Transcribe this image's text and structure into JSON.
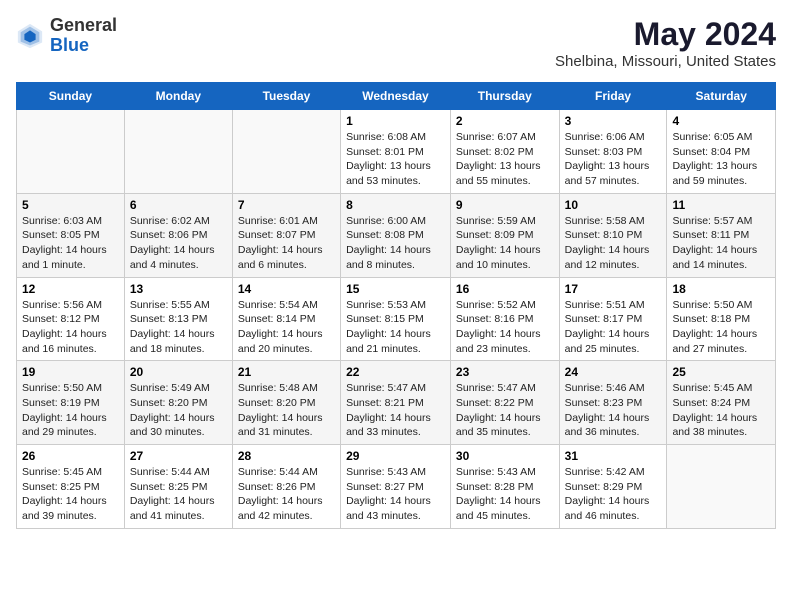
{
  "header": {
    "logo_general": "General",
    "logo_blue": "Blue",
    "title": "May 2024",
    "subtitle": "Shelbina, Missouri, United States"
  },
  "days_of_week": [
    "Sunday",
    "Monday",
    "Tuesday",
    "Wednesday",
    "Thursday",
    "Friday",
    "Saturday"
  ],
  "weeks": [
    [
      {
        "day": "",
        "info": ""
      },
      {
        "day": "",
        "info": ""
      },
      {
        "day": "",
        "info": ""
      },
      {
        "day": "1",
        "info": "Sunrise: 6:08 AM\nSunset: 8:01 PM\nDaylight: 13 hours and 53 minutes."
      },
      {
        "day": "2",
        "info": "Sunrise: 6:07 AM\nSunset: 8:02 PM\nDaylight: 13 hours and 55 minutes."
      },
      {
        "day": "3",
        "info": "Sunrise: 6:06 AM\nSunset: 8:03 PM\nDaylight: 13 hours and 57 minutes."
      },
      {
        "day": "4",
        "info": "Sunrise: 6:05 AM\nSunset: 8:04 PM\nDaylight: 13 hours and 59 minutes."
      }
    ],
    [
      {
        "day": "5",
        "info": "Sunrise: 6:03 AM\nSunset: 8:05 PM\nDaylight: 14 hours and 1 minute."
      },
      {
        "day": "6",
        "info": "Sunrise: 6:02 AM\nSunset: 8:06 PM\nDaylight: 14 hours and 4 minutes."
      },
      {
        "day": "7",
        "info": "Sunrise: 6:01 AM\nSunset: 8:07 PM\nDaylight: 14 hours and 6 minutes."
      },
      {
        "day": "8",
        "info": "Sunrise: 6:00 AM\nSunset: 8:08 PM\nDaylight: 14 hours and 8 minutes."
      },
      {
        "day": "9",
        "info": "Sunrise: 5:59 AM\nSunset: 8:09 PM\nDaylight: 14 hours and 10 minutes."
      },
      {
        "day": "10",
        "info": "Sunrise: 5:58 AM\nSunset: 8:10 PM\nDaylight: 14 hours and 12 minutes."
      },
      {
        "day": "11",
        "info": "Sunrise: 5:57 AM\nSunset: 8:11 PM\nDaylight: 14 hours and 14 minutes."
      }
    ],
    [
      {
        "day": "12",
        "info": "Sunrise: 5:56 AM\nSunset: 8:12 PM\nDaylight: 14 hours and 16 minutes."
      },
      {
        "day": "13",
        "info": "Sunrise: 5:55 AM\nSunset: 8:13 PM\nDaylight: 14 hours and 18 minutes."
      },
      {
        "day": "14",
        "info": "Sunrise: 5:54 AM\nSunset: 8:14 PM\nDaylight: 14 hours and 20 minutes."
      },
      {
        "day": "15",
        "info": "Sunrise: 5:53 AM\nSunset: 8:15 PM\nDaylight: 14 hours and 21 minutes."
      },
      {
        "day": "16",
        "info": "Sunrise: 5:52 AM\nSunset: 8:16 PM\nDaylight: 14 hours and 23 minutes."
      },
      {
        "day": "17",
        "info": "Sunrise: 5:51 AM\nSunset: 8:17 PM\nDaylight: 14 hours and 25 minutes."
      },
      {
        "day": "18",
        "info": "Sunrise: 5:50 AM\nSunset: 8:18 PM\nDaylight: 14 hours and 27 minutes."
      }
    ],
    [
      {
        "day": "19",
        "info": "Sunrise: 5:50 AM\nSunset: 8:19 PM\nDaylight: 14 hours and 29 minutes."
      },
      {
        "day": "20",
        "info": "Sunrise: 5:49 AM\nSunset: 8:20 PM\nDaylight: 14 hours and 30 minutes."
      },
      {
        "day": "21",
        "info": "Sunrise: 5:48 AM\nSunset: 8:20 PM\nDaylight: 14 hours and 31 minutes."
      },
      {
        "day": "22",
        "info": "Sunrise: 5:47 AM\nSunset: 8:21 PM\nDaylight: 14 hours and 33 minutes."
      },
      {
        "day": "23",
        "info": "Sunrise: 5:47 AM\nSunset: 8:22 PM\nDaylight: 14 hours and 35 minutes."
      },
      {
        "day": "24",
        "info": "Sunrise: 5:46 AM\nSunset: 8:23 PM\nDaylight: 14 hours and 36 minutes."
      },
      {
        "day": "25",
        "info": "Sunrise: 5:45 AM\nSunset: 8:24 PM\nDaylight: 14 hours and 38 minutes."
      }
    ],
    [
      {
        "day": "26",
        "info": "Sunrise: 5:45 AM\nSunset: 8:25 PM\nDaylight: 14 hours and 39 minutes."
      },
      {
        "day": "27",
        "info": "Sunrise: 5:44 AM\nSunset: 8:25 PM\nDaylight: 14 hours and 41 minutes."
      },
      {
        "day": "28",
        "info": "Sunrise: 5:44 AM\nSunset: 8:26 PM\nDaylight: 14 hours and 42 minutes."
      },
      {
        "day": "29",
        "info": "Sunrise: 5:43 AM\nSunset: 8:27 PM\nDaylight: 14 hours and 43 minutes."
      },
      {
        "day": "30",
        "info": "Sunrise: 5:43 AM\nSunset: 8:28 PM\nDaylight: 14 hours and 45 minutes."
      },
      {
        "day": "31",
        "info": "Sunrise: 5:42 AM\nSunset: 8:29 PM\nDaylight: 14 hours and 46 minutes."
      },
      {
        "day": "",
        "info": ""
      }
    ]
  ]
}
